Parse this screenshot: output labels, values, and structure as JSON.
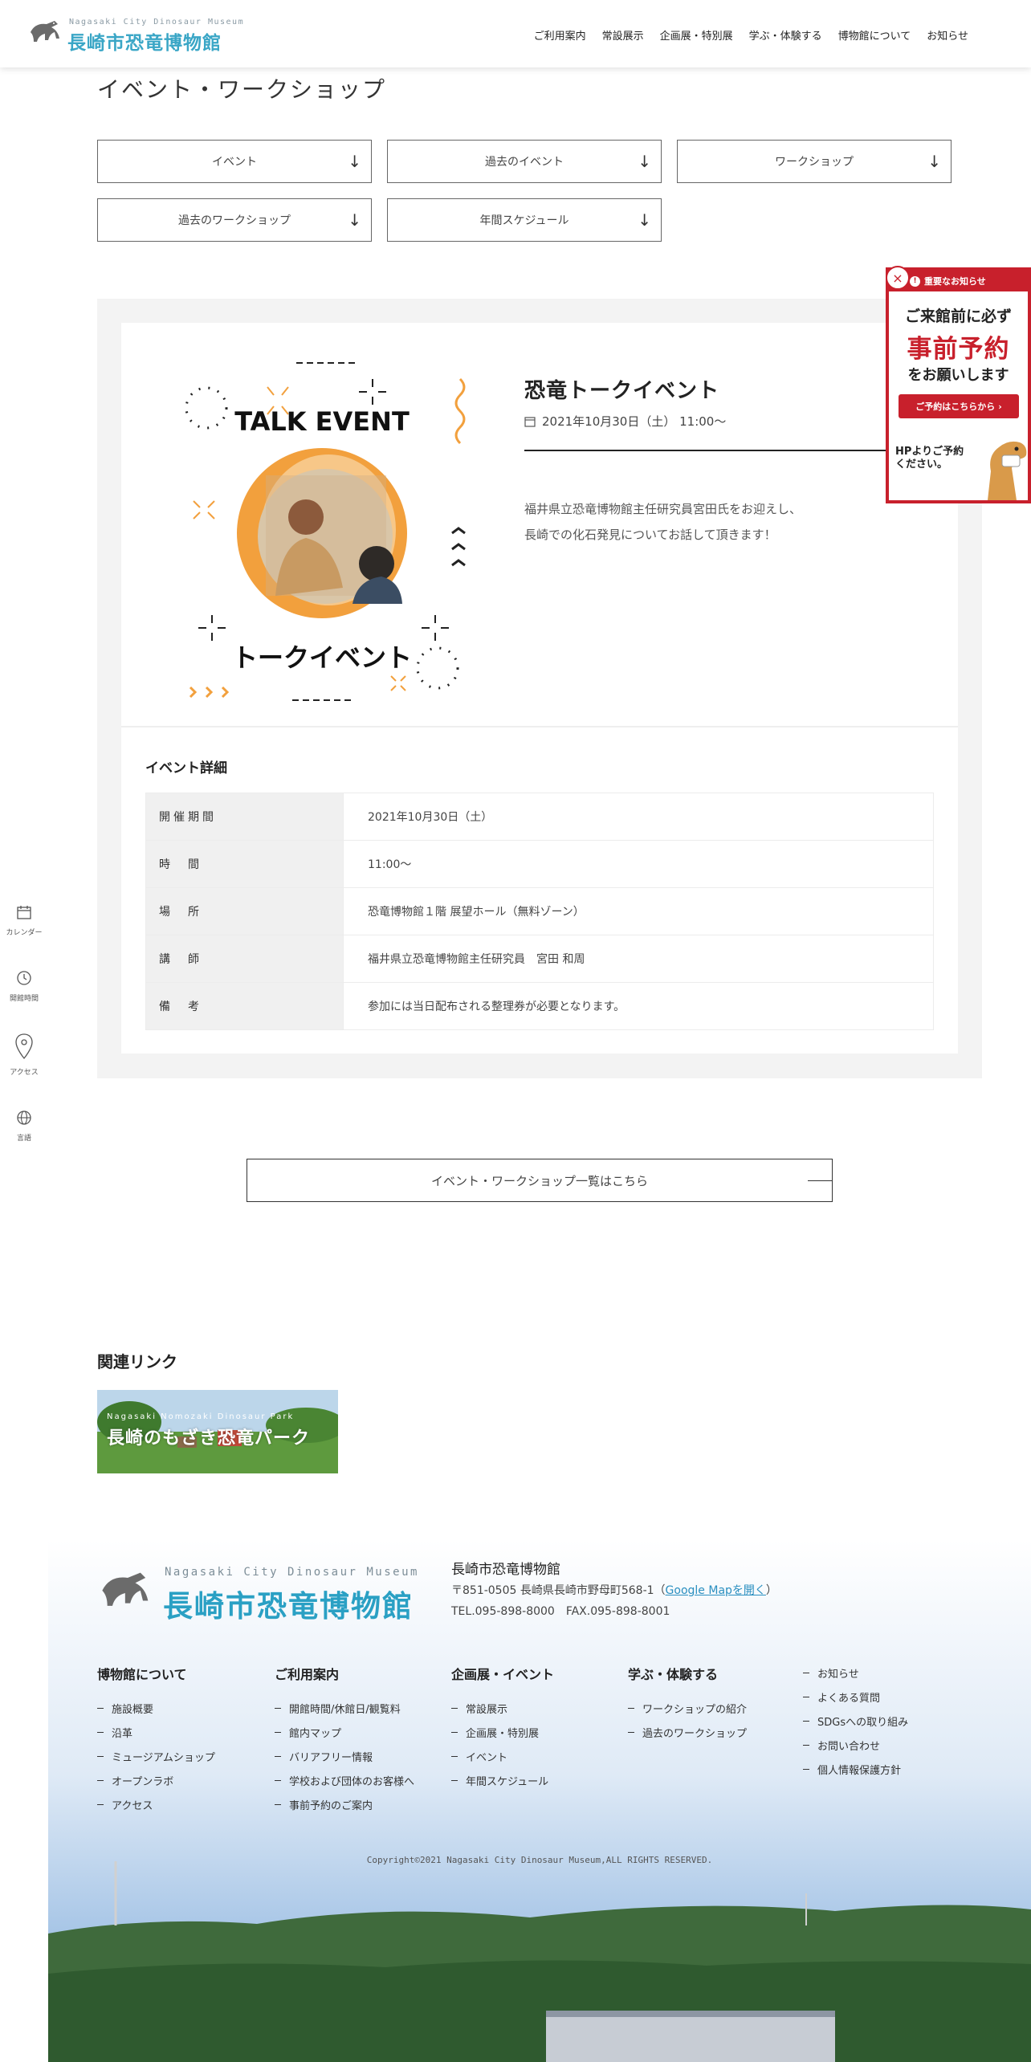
{
  "header": {
    "logo_sub": "Nagasaki City Dinosaur Museum",
    "logo_main": "長崎市恐竜博物館",
    "nav": [
      "ご利用案内",
      "常設展示",
      "企画展・特別展",
      "学ぶ・体験する",
      "博物館について",
      "お知らせ"
    ]
  },
  "page": {
    "title": "イベント・ワークショップ"
  },
  "filters": [
    "イベント",
    "過去のイベント",
    "ワークショップ",
    "過去のワークショップ",
    "年間スケジュール"
  ],
  "filter_arrow": "↓",
  "event": {
    "image_top_text": "TALK EVENT",
    "image_bottom_text": "トークイベント",
    "title": "恐竜トークイベント",
    "date": "2021年10月30日（土） 11:00〜",
    "description": [
      "福井県立恐竜博物館主任研究員宮田氏をお迎えし、",
      "長崎での化石発見についてお話して頂きます！"
    ],
    "details_heading": "イベント詳細",
    "details": [
      {
        "label": "開催期間",
        "value": "2021年10月30日（土）"
      },
      {
        "label": "時　間",
        "value": "11:00〜"
      },
      {
        "label": "場　所",
        "value": "恐竜博物館１階 展望ホール（無料ゾーン）"
      },
      {
        "label": "講　師",
        "value": "福井県立恐竜博物館主任研究員　宮田 和周"
      },
      {
        "label": "備　考",
        "value": "参加には当日配布される整理券が必要となります。"
      }
    ]
  },
  "list_button": "イベント・ワークショップ一覧はこちら",
  "related": {
    "heading": "関連リンク",
    "banner_sub": "Nagasaki Nomozaki Dinosaur Park",
    "banner_main": "長崎のもざき恐竜パーク"
  },
  "side_menu": [
    "カレンダー",
    "開館時間",
    "アクセス",
    "言語"
  ],
  "notice": {
    "bar": "重要なお知らせ",
    "line1": "ご来館前に必ず",
    "line2": "事前予約",
    "line3": "をお願いします",
    "button": "ご予約はこちらから",
    "hp_line1": "HPよりご予約",
    "hp_line2": "ください。",
    "close": "×"
  },
  "footer": {
    "logo_sub": "Nagasaki City Dinosaur Museum",
    "logo_main": "長崎市恐竜博物館",
    "name": "長崎市恐竜博物館",
    "address": "〒851-0505 長崎県長崎市野母町568-1（",
    "map_link": "Google Mapを開く",
    "address_end": "）",
    "tel": "TEL.095-898-8000　FAX.095-898-8001",
    "columns": [
      {
        "heading": "博物館について",
        "items": [
          "施設概要",
          "沿革",
          "ミュージアムショップ",
          "オープンラボ",
          "アクセス"
        ]
      },
      {
        "heading": "ご利用案内",
        "items": [
          "開館時間/休館日/観覧料",
          "館内マップ",
          "バリアフリー情報",
          "学校および団体のお客様へ",
          "事前予約のご案内"
        ]
      },
      {
        "heading": "企画展・イベント",
        "items": [
          "常設展示",
          "企画展・特別展",
          "イベント",
          "年間スケジュール"
        ]
      },
      {
        "heading": "学ぶ・体験する",
        "items": [
          "ワークショップの紹介",
          "過去のワークショップ"
        ]
      },
      {
        "heading": "",
        "items": [
          "お知らせ",
          "よくある質問",
          "SDGsへの取り組み",
          "お問い合わせ",
          "個人情報保護方針"
        ]
      }
    ],
    "copyright": "Copyright©2021 Nagasaki City Dinosaur Museum,ALL RIGHTS RESERVED."
  },
  "colors": {
    "accent_red": "#c8202c",
    "logo_blue": "#3aa6c6",
    "orange": "#f2a03d"
  }
}
